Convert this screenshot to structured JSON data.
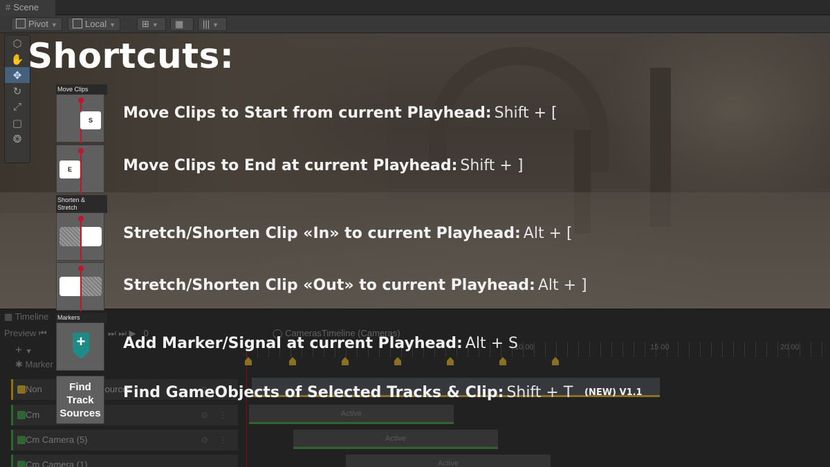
{
  "editor": {
    "scene_tab": "Scene",
    "toolbar": {
      "pivot": "Pivot",
      "local": "Local"
    },
    "tools": [
      "view-icon",
      "move-icon",
      "rotate-icon",
      "scale-icon",
      "rect-icon",
      "transform-icon"
    ],
    "timeline": {
      "tab": "Timeline",
      "preview": "Preview",
      "frame": "0",
      "asset_title": "CamerasTimeline (Cameras)",
      "markers_label": "Marker",
      "ruler": [
        "10.00",
        "15.00",
        "20.00"
      ],
      "tracks": [
        {
          "label": "Non",
          "clip_text": "Sources"
        },
        {
          "label": "Cm",
          "clip_text": "Active"
        },
        {
          "label": "Cm Camera (5)",
          "clip_text": "Active"
        },
        {
          "label": "Cm Camera (1)",
          "clip_text": "Active"
        }
      ]
    }
  },
  "overlay": {
    "title": "Shortcuts:",
    "groups": {
      "move": "Move Clips",
      "stretch": "Shorten & Stretch",
      "markers": "Markers"
    },
    "icons": {
      "start_key": "S",
      "end_key": "E",
      "marker_plus": "+",
      "find_line1": "Find",
      "find_line2": "Track",
      "find_line3": "Sources"
    },
    "shortcuts": [
      {
        "desc": "Move Clips to Start from current Playhead:",
        "keys": "Shift + ["
      },
      {
        "desc": "Move Clips to End at current Playhead:",
        "keys": "Shift + ]"
      },
      {
        "desc": "Stretch/Shorten Clip «In» to current Playhead:",
        "keys": "Alt + ["
      },
      {
        "desc": "Stretch/Shorten Clip «Out» to current Playhead:",
        "keys": "Alt + ]"
      },
      {
        "desc": "Add Marker/Signal at current Playhead:",
        "keys": "Alt + S"
      },
      {
        "desc": "Find GameObjects of Selected Tracks & Clip:",
        "keys": "Shift + T"
      }
    ],
    "new_tag": "(NEW) V1.1"
  },
  "colors": {
    "playhead": "#c0162a",
    "marker": "#1f8a86",
    "track_green": "#3f8f3f",
    "track_gold": "#c8a12a"
  }
}
